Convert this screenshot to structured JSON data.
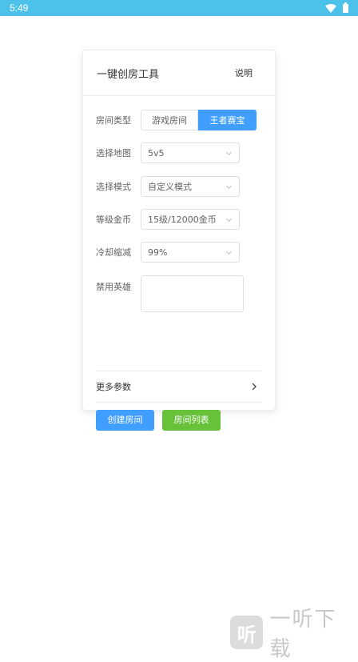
{
  "status_bar": {
    "time": "5:49"
  },
  "card": {
    "title": "一键创房工具",
    "help_label": "说明"
  },
  "form": {
    "room_type": {
      "label": "房间类型",
      "options": [
        "游戏房间",
        "王者赛宝"
      ],
      "selected": "王者赛宝"
    },
    "map": {
      "label": "选择地图",
      "value": "5v5"
    },
    "mode": {
      "label": "选择模式",
      "value": "自定义模式"
    },
    "level_gold": {
      "label": "等级金币",
      "value": "15级/12000金币"
    },
    "cooldown": {
      "label": "冷却缩减",
      "value": "99%"
    },
    "ban_heroes": {
      "label": "禁用英雄",
      "value": ""
    },
    "more_params_label": "更多参数"
  },
  "buttons": {
    "create": "创建房间",
    "list": "房间列表"
  },
  "colors": {
    "primary": "#409eff",
    "success": "#67c23a",
    "status_bar": "#4cc2ea"
  },
  "watermark": {
    "logo_glyph": "听",
    "text": "一听下载"
  }
}
